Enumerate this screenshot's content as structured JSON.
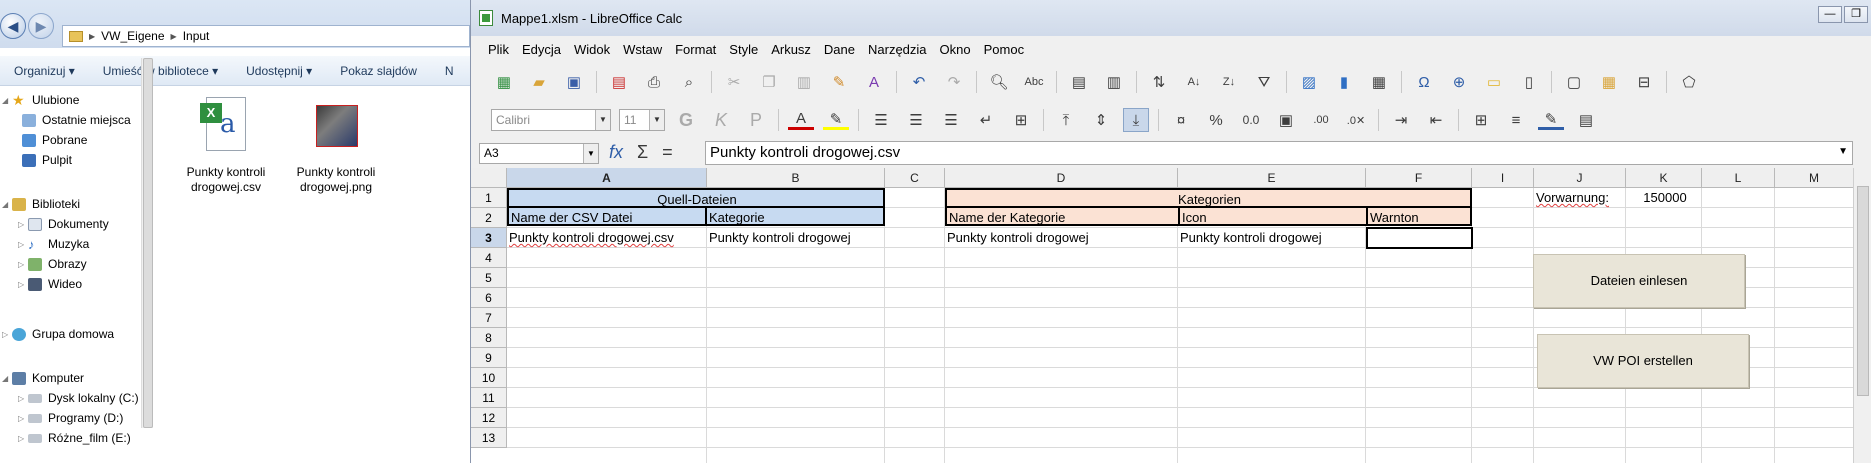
{
  "explorer": {
    "breadcrumb": [
      "VW_Eigene",
      "Input"
    ],
    "toolbar": [
      "Organizuj ▾",
      "Umieść w bibliotece ▾",
      "Udostępnij ▾",
      "Pokaz slajdów",
      "N"
    ],
    "nav": {
      "favorites": "Ulubione",
      "recent": "Ostatnie miejsca",
      "downloads": "Pobrane",
      "desktop": "Pulpit",
      "libraries": "Biblioteki",
      "documents": "Dokumenty",
      "music": "Muzyka",
      "pictures": "Obrazy",
      "video": "Wideo",
      "homegroup": "Grupa domowa",
      "computer": "Komputer",
      "disk_c": "Dysk lokalny (C:)",
      "disk_d": "Programy (D:)",
      "disk_e": "Różne_film (E:)"
    },
    "files": [
      {
        "name_l1": "Punkty kontroli",
        "name_l2": "drogowej.csv",
        "icon": "csv-file-icon"
      },
      {
        "name_l1": "Punkty kontroli",
        "name_l2": "drogowej.png",
        "icon": "image-file-icon"
      }
    ]
  },
  "calc": {
    "title": "Mappe1.xlsm - LibreOffice Calc",
    "window_buttons": {
      "minimize": "—",
      "restore": "❐"
    },
    "menu": [
      "Plik",
      "Edycja",
      "Widok",
      "Wstaw",
      "Format",
      "Style",
      "Arkusz",
      "Dane",
      "Narzędzia",
      "Okno",
      "Pomoc"
    ],
    "font_name": "Calibri",
    "font_size": "11",
    "name_box": "A3",
    "formula": "Punkty kontroli drogowej.csv",
    "columns": [
      "A",
      "B",
      "C",
      "D",
      "E",
      "F",
      "I",
      "J",
      "K",
      "L",
      "M"
    ],
    "rows": [
      "1",
      "2",
      "3",
      "4",
      "5",
      "6",
      "7",
      "8",
      "9",
      "10",
      "11",
      "12",
      "13"
    ],
    "cells": {
      "A1": "Quell-Dateien",
      "D1": "Kategorien",
      "A2": "Name der CSV Datei",
      "B2": "Kategorie",
      "D2": "Name der Kategorie",
      "E2": "Icon",
      "F2": "Warnton",
      "A3": "Punkty kontroli drogowej.csv",
      "B3": "Punkty kontroli drogowej",
      "D3": "Punkty kontroli drogowej",
      "E3": "Punkty kontroli drogowej",
      "J1": "Vorwarnung:",
      "K1": "150000"
    },
    "buttons": {
      "read_files": "Dateien einlesen",
      "create_poi": "VW POI erstellen"
    },
    "colors": {
      "blue_band": "#c7daf1",
      "orange_band": "#fbe2d4",
      "button": "#e9e5d8"
    }
  }
}
